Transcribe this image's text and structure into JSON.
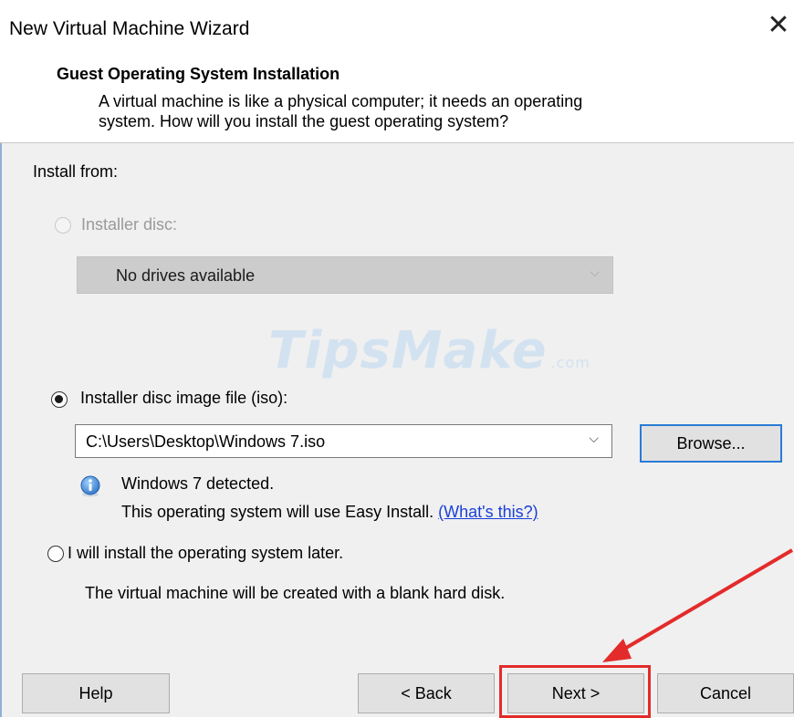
{
  "window": {
    "title": "New Virtual Machine Wizard",
    "close_icon": "close-icon"
  },
  "header": {
    "title": "Guest Operating System Installation",
    "description_line1": "A virtual machine is like a physical computer; it needs an operating",
    "description_line2": "system. How will you install the guest operating system?"
  },
  "install": {
    "label": "Install from:",
    "disc_option": {
      "label": "Installer disc:",
      "enabled": false,
      "selected": false
    },
    "disc_combo": {
      "value": "No drives available"
    },
    "iso_option": {
      "label": "Installer disc image file (iso):",
      "selected": true
    },
    "iso_combo": {
      "value": "C:\\Users\\Desktop\\Windows 7.iso"
    },
    "browse_label": "Browse...",
    "detected_text": "Windows 7 detected.",
    "easy_install_text": "This operating system will use Easy Install.",
    "whats_this_link": "(What's this?)",
    "later_option": {
      "label": "I will install the operating system later.",
      "selected": false
    },
    "later_desc": "The virtual machine will be created with a blank hard disk."
  },
  "footer": {
    "help_label": "Help",
    "back_label": "< Back",
    "next_label": "Next >",
    "cancel_label": "Cancel"
  },
  "watermark": {
    "text": "TipsMake",
    "suffix": ".com"
  },
  "colors": {
    "accent": "#2a7bd6",
    "annotation": "#e32b2b",
    "link": "#1a3fd6",
    "panel": "#f0f0f0"
  }
}
